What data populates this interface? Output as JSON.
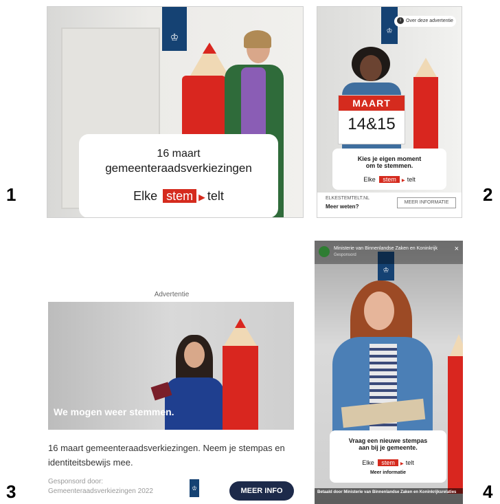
{
  "labels": [
    "1",
    "2",
    "3",
    "4"
  ],
  "ad1": {
    "date_line": "16 maart",
    "title_line": "gemeenteraadsverkiezingen",
    "slogan": {
      "pre": "Elke",
      "highlight": "stem",
      "post": "telt"
    }
  },
  "ad2": {
    "info_pill": "Over deze advertentie",
    "sign_month": "MAART",
    "sign_days": "14&15",
    "card_line1": "Kies je eigen moment",
    "card_line2": "om te stemmen.",
    "slogan": {
      "pre": "Elke",
      "highlight": "stem",
      "post": "telt"
    },
    "footer_domain": "ELKESTEMTELT.NL",
    "footer_link": "Meer weten?",
    "cta": "MEER INFORMATIE"
  },
  "ad3": {
    "ad_label": "Advertentie",
    "caption": "We mogen weer stemmen.",
    "description": "16 maart gemeenteraadsverkiezingen. Neem je stempas en identiteitsbewijs mee.",
    "sponsored_label": "Gesponsord door:",
    "sponsor": "Gemeenteraadsverkiezingen 2022",
    "cta": "MEER INFO"
  },
  "ad4": {
    "account": "Ministerie van Binnenlandse Zaken en Koninkrijk",
    "sponsored": "Gesponsord",
    "close": "×",
    "card_line1": "Vraag een nieuwe stempas",
    "card_line2": "aan bij je gemeente.",
    "slogan": {
      "pre": "Elke",
      "highlight": "stem",
      "post": "telt"
    },
    "more": "Meer informatie",
    "paid_by": "Betaald door Ministerie van Binnenlandse Zaken en Koninkrijksrelaties"
  },
  "colors": {
    "rijk_blue": "#154273",
    "stem_red": "#d52b1e",
    "cta_dark": "#1d2a4a"
  }
}
